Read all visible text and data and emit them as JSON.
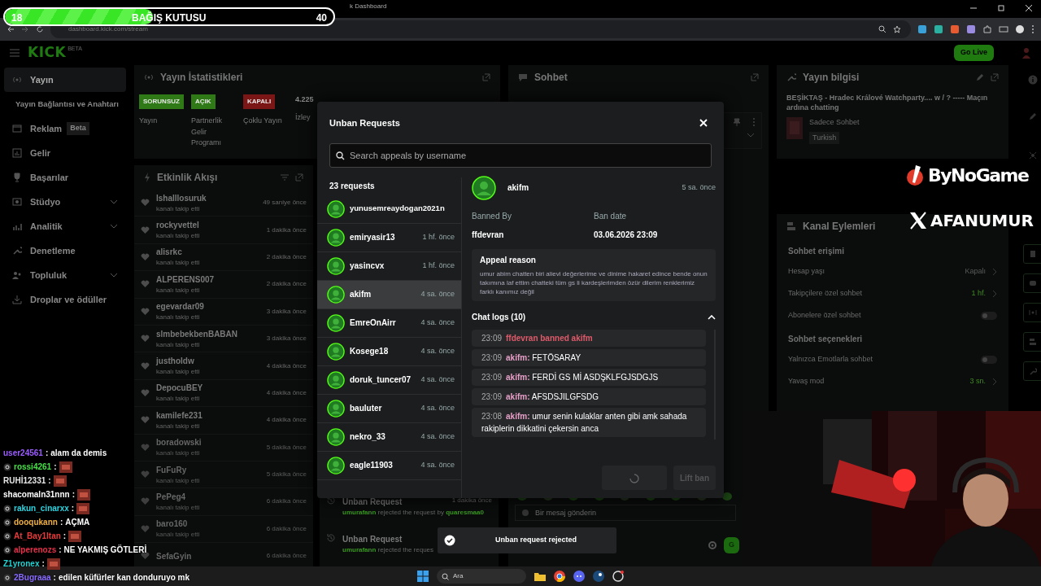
{
  "donation_bar": {
    "current": "18",
    "label": "BAĞIŞ KUTUSU",
    "goal": "40",
    "level": 0.45
  },
  "browser": {
    "tab_title": "k Dashboard",
    "url": "dashboard.kick.com/stream"
  },
  "header": {
    "logo": "KICK",
    "logo_tag": "BETA",
    "go_live": "Go Live"
  },
  "sidebar": {
    "items": [
      {
        "label": "Yayın",
        "selected": true,
        "kind": "main"
      },
      {
        "label": "Yayın Bağlantısı ve Anahtarı",
        "selected": false,
        "kind": "sub"
      },
      {
        "label": "Reklam",
        "badge": "Beta",
        "selected": false,
        "kind": "main"
      },
      {
        "label": "Gelir",
        "selected": false,
        "kind": "main"
      },
      {
        "label": "Başarılar",
        "selected": false,
        "kind": "main"
      },
      {
        "label": "Stüdyo",
        "selected": false,
        "kind": "group"
      },
      {
        "label": "Analitik",
        "selected": false,
        "kind": "group"
      },
      {
        "label": "Denetleme",
        "selected": false,
        "kind": "main"
      },
      {
        "label": "Topluluk",
        "selected": false,
        "kind": "group"
      },
      {
        "label": "Droplar ve ödüller",
        "selected": false,
        "kind": "main"
      }
    ]
  },
  "stats": {
    "title": "Yayın İstatistikleri",
    "statuses": [
      {
        "badge": "SORUNSUZ",
        "label": "Yayın",
        "color": "#2f7a16"
      },
      {
        "badge": "AÇIK",
        "label": "Partnerlik Gelir Programı",
        "color": "#2f7a16"
      },
      {
        "badge": "KAPALI",
        "label": "Çoklu Yayın",
        "color": "#7a1616"
      }
    ],
    "viewers": "4.225",
    "viewers_label": "İzley"
  },
  "activity": {
    "title": "Etkinlik Akışı",
    "items": [
      {
        "user": "lshalllosuruk",
        "action": "kanalı takip etti",
        "time": "49 saniye önce"
      },
      {
        "user": "rockyvettel",
        "action": "kanalı takip etti",
        "time": "1 dakika önce"
      },
      {
        "user": "alisrkc",
        "action": "kanalı takip etti",
        "time": "2 dakika önce"
      },
      {
        "user": "ALPERENS007",
        "action": "kanalı takip etti",
        "time": "2 dakika önce"
      },
      {
        "user": "egevardar09",
        "action": "kanalı takip etti",
        "time": "3 dakika önce"
      },
      {
        "user": "slmbebekbenBABAN",
        "action": "kanalı takip etti",
        "time": "3 dakika önce"
      },
      {
        "user": "justholdw",
        "action": "kanalı takip etti",
        "time": "4 dakika önce"
      },
      {
        "user": "DepocuBEY",
        "action": "kanalı takip etti",
        "time": "4 dakika önce"
      },
      {
        "user": "kamilefe231",
        "action": "kanalı takip etti",
        "time": "4 dakika önce"
      },
      {
        "user": "boradowski",
        "action": "kanalı takip etti",
        "time": "5 dakika önce"
      },
      {
        "user": "FuFuRy",
        "action": "kanalı takip etti",
        "time": "5 dakika önce"
      },
      {
        "user": "PePeg4",
        "action": "kanalı takip etti",
        "time": "6 dakika önce"
      },
      {
        "user": "baro160",
        "action": "kanalı takip etti",
        "time": "6 dakika önce"
      },
      {
        "user": "SefaGyin",
        "time": "6 dakika önce"
      }
    ]
  },
  "mod_log": {
    "items": [
      {
        "title": "Unban Request",
        "time": "1 dakika önce",
        "actor": "umurafann",
        "text": "rejected the request by",
        "target": "quaresmaa0"
      },
      {
        "title": "Unban Request",
        "actor": "umurafann",
        "text": "rejected the reques"
      }
    ]
  },
  "chat": {
    "title": "Sohbet",
    "input": {
      "placeholder": "Bir mesaj gönderin"
    },
    "send": "G"
  },
  "stream_info": {
    "title": "Yayın bilgisi",
    "stream_title": "BEŞİKTAŞ - Hradec Králové Watchparty.... w / ? ----- Maçın ardına chatting",
    "category": "Sadece Sohbet",
    "tag": "Turkish"
  },
  "channel_actions": {
    "title": "Kanal Eylemleri",
    "sections": [
      {
        "heading": "Sohbet erişimi",
        "rows": [
          {
            "kind": "value",
            "label": "Hesap yaşı",
            "value": "Kapalı",
            "active": false
          },
          {
            "kind": "value",
            "label": "Takipçilere özel sohbet",
            "value": "1 hf.",
            "active": true
          },
          {
            "kind": "toggle",
            "label": "Abonelere özel sohbet",
            "on": false
          }
        ]
      },
      {
        "heading": "Sohbet seçenekleri",
        "rows": [
          {
            "kind": "toggle",
            "label": "Yalnızca Emotlarla sohbet",
            "on": false
          },
          {
            "kind": "value",
            "label": "Yavaş mod",
            "value": "3 sn.",
            "active": true
          }
        ]
      }
    ]
  },
  "overlay": {
    "sponsor": "ByNoGame",
    "social": "AFANUMUR"
  },
  "stream_chat": [
    {
      "user": "user24561",
      "color": "#9b5cff",
      "badge": false,
      "separator": ":",
      "message": "alam da demis"
    },
    {
      "user": "rossi4261",
      "color": "#45e045",
      "badge": true,
      "separator": ":",
      "emote": true
    },
    {
      "user": "RUHİ12331",
      "color": "#e6e6e6",
      "badge": false,
      "separator": ":",
      "emote": true
    },
    {
      "user": "shacomaln31nnn",
      "color": "#ffffff",
      "badge": false,
      "separator": ":",
      "emote": true
    },
    {
      "user": "rakun_cinarxx",
      "color": "#2ad3e0",
      "badge": true,
      "separator": ":",
      "emote": true
    },
    {
      "user": "dooqukann",
      "color": "#f0b040",
      "badge": true,
      "separator": ":",
      "message": "AÇMA"
    },
    {
      "user": "At_Bay1ltan",
      "color": "#e83a3a",
      "badge": true,
      "separator": ":",
      "emote": true
    },
    {
      "user": "alperenozs",
      "color": "#e8304a",
      "badge": true,
      "separator": ":",
      "message": "NE YAKMIŞ GÖTLERİ"
    },
    {
      "user": "Z1yronex",
      "color": "#22d3d3",
      "badge": false,
      "separator": ":",
      "emote": true
    },
    {
      "user": "2Bugraaa",
      "color": "#8a6cff",
      "badge": true,
      "separator": ":",
      "message": "edilen küfürler kan donduruyo mk"
    }
  ],
  "modal": {
    "title": "Unban Requests",
    "search": {
      "placeholder": "Search appeals by username"
    },
    "count": "23 requests",
    "requests": [
      {
        "user": "yunusemreaydogan2021n",
        "selected": false
      },
      {
        "user": "emiryasir13",
        "time": "1 hf. önce",
        "selected": false
      },
      {
        "user": "yasincvx",
        "time": "1 hf. önce",
        "selected": false
      },
      {
        "user": "akifm",
        "time": "4 sa. önce",
        "selected": true
      },
      {
        "user": "EmreOnAirr",
        "time": "4 sa. önce",
        "selected": false
      },
      {
        "user": "Kosege18",
        "time": "4 sa. önce",
        "selected": false
      },
      {
        "user": "doruk_tuncer07",
        "time": "4 sa. önce",
        "selected": false
      },
      {
        "user": "bauluter",
        "time": "4 sa. önce",
        "selected": false
      },
      {
        "user": "nekro_33",
        "time": "4 sa. önce",
        "selected": false
      },
      {
        "user": "eagle11903",
        "time": "4 sa. önce",
        "selected": false
      }
    ],
    "detail": {
      "user": "akifm",
      "time": "5 sa. önce",
      "banned_by_label": "Banned By",
      "banned_by": "ffdevran",
      "ban_date_label": "Ban date",
      "ban_date": "03.06.2026 23:09",
      "appeal_title": "Appeal reason",
      "appeal": "umur abim chatten biri alievi değerlerime ve dinime hakaret edince bende onun takımına laf ettim chatteki tüm gs li kardeşlerimden özür dilerim renklerimiz farklı kanımız değil",
      "logs_title": "Chat logs (10)",
      "logs_expanded": true,
      "logs": [
        {
          "kind": "system",
          "time": "23:09",
          "text": "ffdevran banned akifm"
        },
        {
          "kind": "message",
          "time": "23:09",
          "user": "akifm:",
          "text": "FETÖSARAY"
        },
        {
          "kind": "message",
          "time": "23:09",
          "user": "akifm:",
          "text": "FERDİ GS Mİ ASDŞKLFGJSDGJS"
        },
        {
          "kind": "message",
          "time": "23:09",
          "user": "akifm:",
          "text": "AFSDSJILGFSDG"
        },
        {
          "kind": "message",
          "time": "23:08",
          "user": "akifm:",
          "text": "umur senin kulaklar anten gibi amk sahada rakiplerin dikkatini çekersin anca"
        }
      ]
    },
    "buttons": [
      {
        "kind": "spinner",
        "disabled": true
      },
      {
        "kind": "text",
        "label": "Lift ban",
        "disabled": true
      }
    ]
  },
  "toast": {
    "text": "Unban request rejected"
  },
  "taskbar": {
    "search": "Ara"
  }
}
